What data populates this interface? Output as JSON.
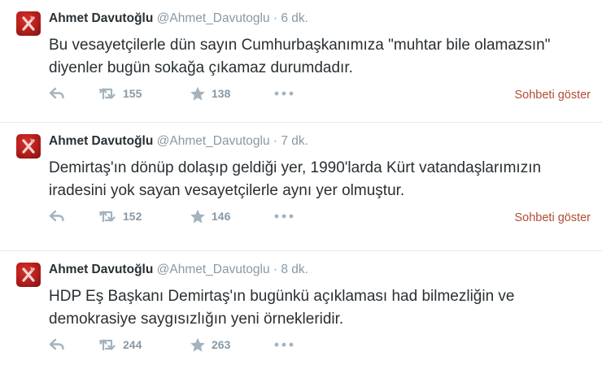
{
  "colors": {
    "link": "#b14c31",
    "muted": "#8899a6",
    "text": "#292f33",
    "divider": "#e1e8ed",
    "avatar": "#c4211c"
  },
  "tweets": [
    {
      "fullname": "Ahmet Davutoğlu",
      "handle": "@Ahmet_Davutoglu",
      "dot": "·",
      "time": "6 dk.",
      "text": "Bu vesayetçilerle dün sayın Cumhurbaşkanımıza \"muhtar bile olamazsın\" diyenler bugün sokağa çıkamaz durumdadır.",
      "retweets": "155",
      "favorites": "138",
      "conversation_label": "Sohbeti göster",
      "icons": [
        "reply-icon",
        "retweet-icon",
        "star-icon",
        "more-icon"
      ]
    },
    {
      "fullname": "Ahmet Davutoğlu",
      "handle": "@Ahmet_Davutoglu",
      "dot": "·",
      "time": "7 dk.",
      "text": "Demirtaş'ın dönüp dolaşıp geldiği yer, 1990'larda Kürt vatandaşlarımızın iradesini yok sayan vesayetçilerle aynı yer olmuştur.",
      "retweets": "152",
      "favorites": "146",
      "conversation_label": "Sohbeti göster",
      "icons": [
        "reply-icon",
        "retweet-icon",
        "star-icon",
        "more-icon"
      ]
    },
    {
      "fullname": "Ahmet Davutoğlu",
      "handle": "@Ahmet_Davutoglu",
      "dot": "·",
      "time": "8 dk.",
      "text": "HDP Eş Başkanı Demirtaş'ın bugünkü açıklaması had bilmezliğin ve demokrasiye saygısızlığın yeni örnekleridir.",
      "retweets": "244",
      "favorites": "263",
      "conversation_label": "",
      "icons": [
        "reply-icon",
        "retweet-icon",
        "star-icon",
        "more-icon"
      ]
    }
  ]
}
